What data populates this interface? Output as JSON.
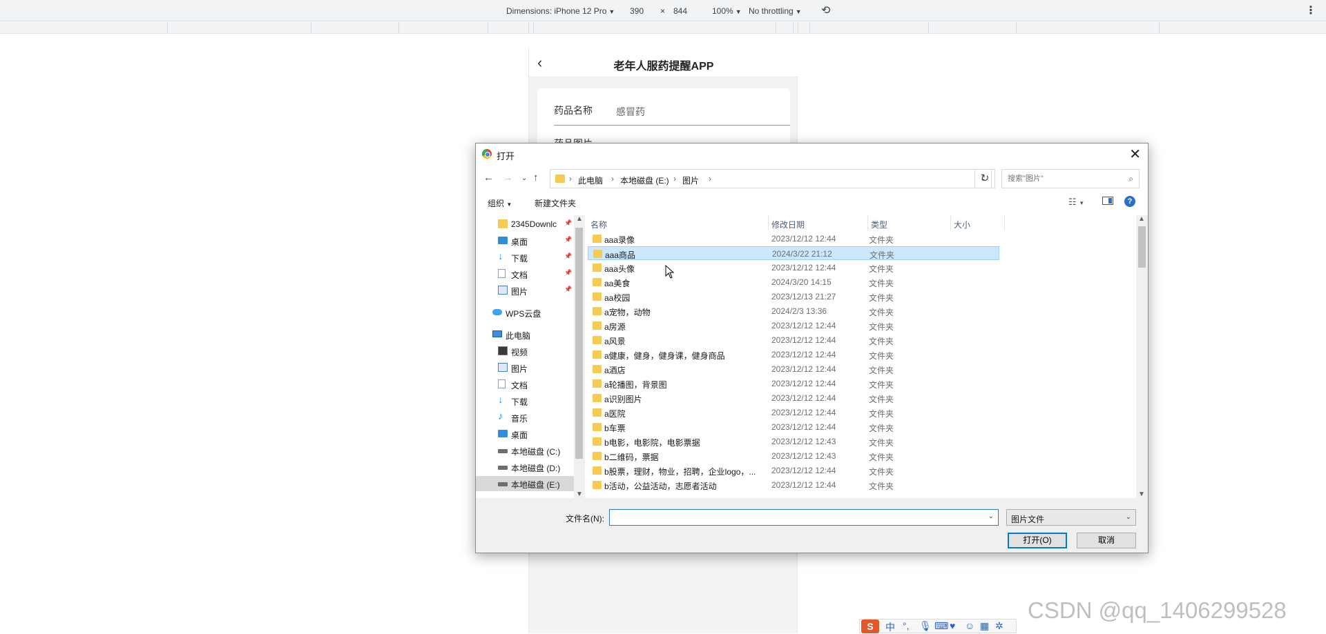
{
  "devtools": {
    "dimensions_label": "Dimensions: iPhone 12 Pro",
    "width": "390",
    "times": "×",
    "height": "844",
    "zoom": "100%",
    "throttling": "No throttling"
  },
  "phone": {
    "title": "老年人服药提醒APP",
    "field_label": "药品名称",
    "field_value": "感冒药",
    "field2_label": "药品图片"
  },
  "dialog": {
    "title": "打开",
    "breadcrumb": [
      "此电脑",
      "本地磁盘 (E:)",
      "图片"
    ],
    "search_placeholder": "搜索\"图片\"",
    "organize": "组织",
    "new_folder": "新建文件夹",
    "columns": {
      "name": "名称",
      "date": "修改日期",
      "type": "类型",
      "size": "大小"
    },
    "tree": [
      {
        "label": "2345Downlc",
        "icon": "folder-icon",
        "pinned": true
      },
      {
        "label": "桌面",
        "icon": "desktop-icon",
        "pinned": true
      },
      {
        "label": "下载",
        "icon": "download-icon",
        "pinned": true
      },
      {
        "label": "文档",
        "icon": "document-icon",
        "pinned": true
      },
      {
        "label": "图片",
        "icon": "pictures-icon",
        "pinned": true
      },
      {
        "label": "WPS云盘",
        "icon": "cloud-icon",
        "pinned": false
      },
      {
        "label": "此电脑",
        "icon": "computer-icon",
        "pinned": false
      },
      {
        "label": "视频",
        "icon": "video-icon",
        "pinned": false
      },
      {
        "label": "图片",
        "icon": "pictures-icon",
        "pinned": false
      },
      {
        "label": "文档",
        "icon": "document-icon",
        "pinned": false
      },
      {
        "label": "下载",
        "icon": "download-icon",
        "pinned": false
      },
      {
        "label": "音乐",
        "icon": "music-icon",
        "pinned": false
      },
      {
        "label": "桌面",
        "icon": "desktop-icon",
        "pinned": false
      },
      {
        "label": "本地磁盘 (C:)",
        "icon": "drive-icon",
        "pinned": false
      },
      {
        "label": "本地磁盘 (D:)",
        "icon": "drive-icon",
        "pinned": false
      },
      {
        "label": "本地磁盘 (E:)",
        "icon": "drive-icon",
        "pinned": false,
        "selected": true
      }
    ],
    "files": [
      {
        "name": "aaa录像",
        "date": "2023/12/12 12:44",
        "type": "文件夹"
      },
      {
        "name": "aaa商品",
        "date": "2024/3/22 21:12",
        "type": "文件夹",
        "selected": true
      },
      {
        "name": "aaa头像",
        "date": "2023/12/12 12:44",
        "type": "文件夹"
      },
      {
        "name": "aa美食",
        "date": "2024/3/20 14:15",
        "type": "文件夹"
      },
      {
        "name": "aa校园",
        "date": "2023/12/13 21:27",
        "type": "文件夹"
      },
      {
        "name": "a宠物，动物",
        "date": "2024/2/3 13:36",
        "type": "文件夹"
      },
      {
        "name": "a房源",
        "date": "2023/12/12 12:44",
        "type": "文件夹"
      },
      {
        "name": "a风景",
        "date": "2023/12/12 12:44",
        "type": "文件夹"
      },
      {
        "name": "a健康，健身，健身课，健身商品",
        "date": "2023/12/12 12:44",
        "type": "文件夹"
      },
      {
        "name": "a酒店",
        "date": "2023/12/12 12:44",
        "type": "文件夹"
      },
      {
        "name": "a轮播图，背景图",
        "date": "2023/12/12 12:44",
        "type": "文件夹"
      },
      {
        "name": "a识别图片",
        "date": "2023/12/12 12:44",
        "type": "文件夹"
      },
      {
        "name": "a医院",
        "date": "2023/12/12 12:44",
        "type": "文件夹"
      },
      {
        "name": "b车票",
        "date": "2023/12/12 12:44",
        "type": "文件夹"
      },
      {
        "name": "b电影，电影院，电影票据",
        "date": "2023/12/12 12:43",
        "type": "文件夹"
      },
      {
        "name": "b二维码，票据",
        "date": "2023/12/12 12:43",
        "type": "文件夹"
      },
      {
        "name": "b股票，理财，物业，招聘，企业logo，...",
        "date": "2023/12/12 12:44",
        "type": "文件夹"
      },
      {
        "name": "b活动，公益活动，志愿者活动",
        "date": "2023/12/12 12:44",
        "type": "文件夹"
      }
    ],
    "filename_label": "文件名(N):",
    "filename_value": "",
    "filetype": "图片文件",
    "open_button": "打开(O)",
    "cancel_button": "取消"
  },
  "ime": {
    "logo": "S",
    "mode": "中"
  },
  "watermark": "CSDN @qq_1406299528"
}
